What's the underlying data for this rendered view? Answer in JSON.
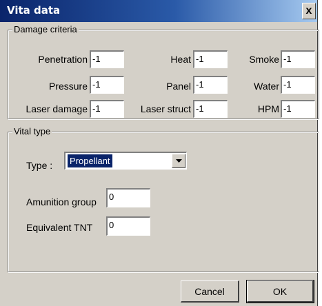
{
  "window": {
    "title": "Vita data",
    "close_glyph": "x"
  },
  "damage_criteria": {
    "legend": "Damage criteria",
    "fields": [
      {
        "label": "Penetration",
        "value": "-1"
      },
      {
        "label": "Heat",
        "value": "-1"
      },
      {
        "label": "Smoke",
        "value": "-1"
      },
      {
        "label": "Pressure",
        "value": "-1"
      },
      {
        "label": "Panel",
        "value": "-1"
      },
      {
        "label": "Water",
        "value": "-1"
      },
      {
        "label": "Laser damage",
        "value": "-1"
      },
      {
        "label": "Laser struct",
        "value": "-1"
      },
      {
        "label": "HPM",
        "value": "-1"
      }
    ]
  },
  "vital_type": {
    "legend": "Vital type",
    "type_label": "Type :",
    "type_value": "Propellant",
    "amunition_label": "Amunition group",
    "amunition_value": "0",
    "tnt_label": "Equivalent TNT",
    "tnt_value": "0"
  },
  "buttons": {
    "cancel": "Cancel",
    "ok": "OK"
  },
  "icons": {
    "close": "close-icon",
    "dropdown": "triangle-down-icon"
  },
  "colors": {
    "titlebar": "#0a246a",
    "face": "#d4d0c8",
    "selection": "#0a246a"
  }
}
